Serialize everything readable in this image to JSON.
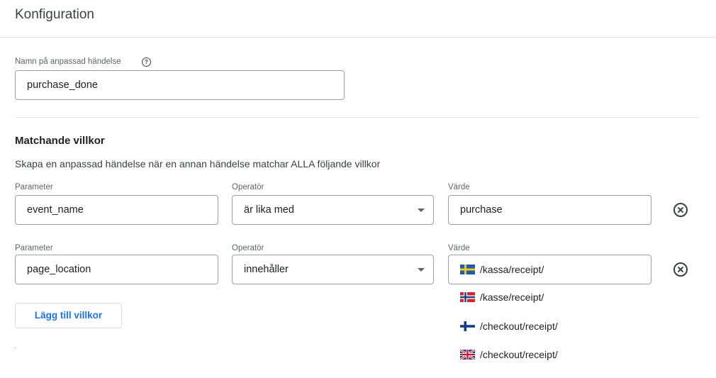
{
  "header": {
    "title": "Konfiguration"
  },
  "event_name": {
    "label": "Namn på anpassad händelse",
    "help_icon": "help-circle-icon",
    "value": "purchase_done"
  },
  "matching": {
    "title": "Matchande villkor",
    "description": "Skapa en anpassad händelse när en annan händelse matchar ALLA följande villkor"
  },
  "conditions": [
    {
      "param_label": "Parameter",
      "param_value": "event_name",
      "op_label": "Operatör",
      "op_value": "är lika med",
      "val_label": "Värde",
      "val_value": "purchase",
      "remove_icon": "remove-circle-icon"
    },
    {
      "param_label": "Parameter",
      "param_value": "page_location",
      "op_label": "Operatör",
      "op_value": "innehåller",
      "val_label": "Värde",
      "val_value": "/kassa/receipt/",
      "val_flag": "sweden-flag-icon",
      "remove_icon": "remove-circle-icon"
    }
  ],
  "suggestions": [
    {
      "flag": "norway-flag-icon",
      "text": "/kasse/receipt/"
    },
    {
      "flag": "finland-flag-icon",
      "text": "/checkout/receipt/"
    },
    {
      "flag": "uk-flag-icon",
      "text": "/checkout/receipt/"
    }
  ],
  "add_condition_label": "Lägg till villkor",
  "colors": {
    "accent": "#1a73e8",
    "border": "#9aa0a6",
    "divider": "#e3e3e3",
    "text": "#202124"
  }
}
